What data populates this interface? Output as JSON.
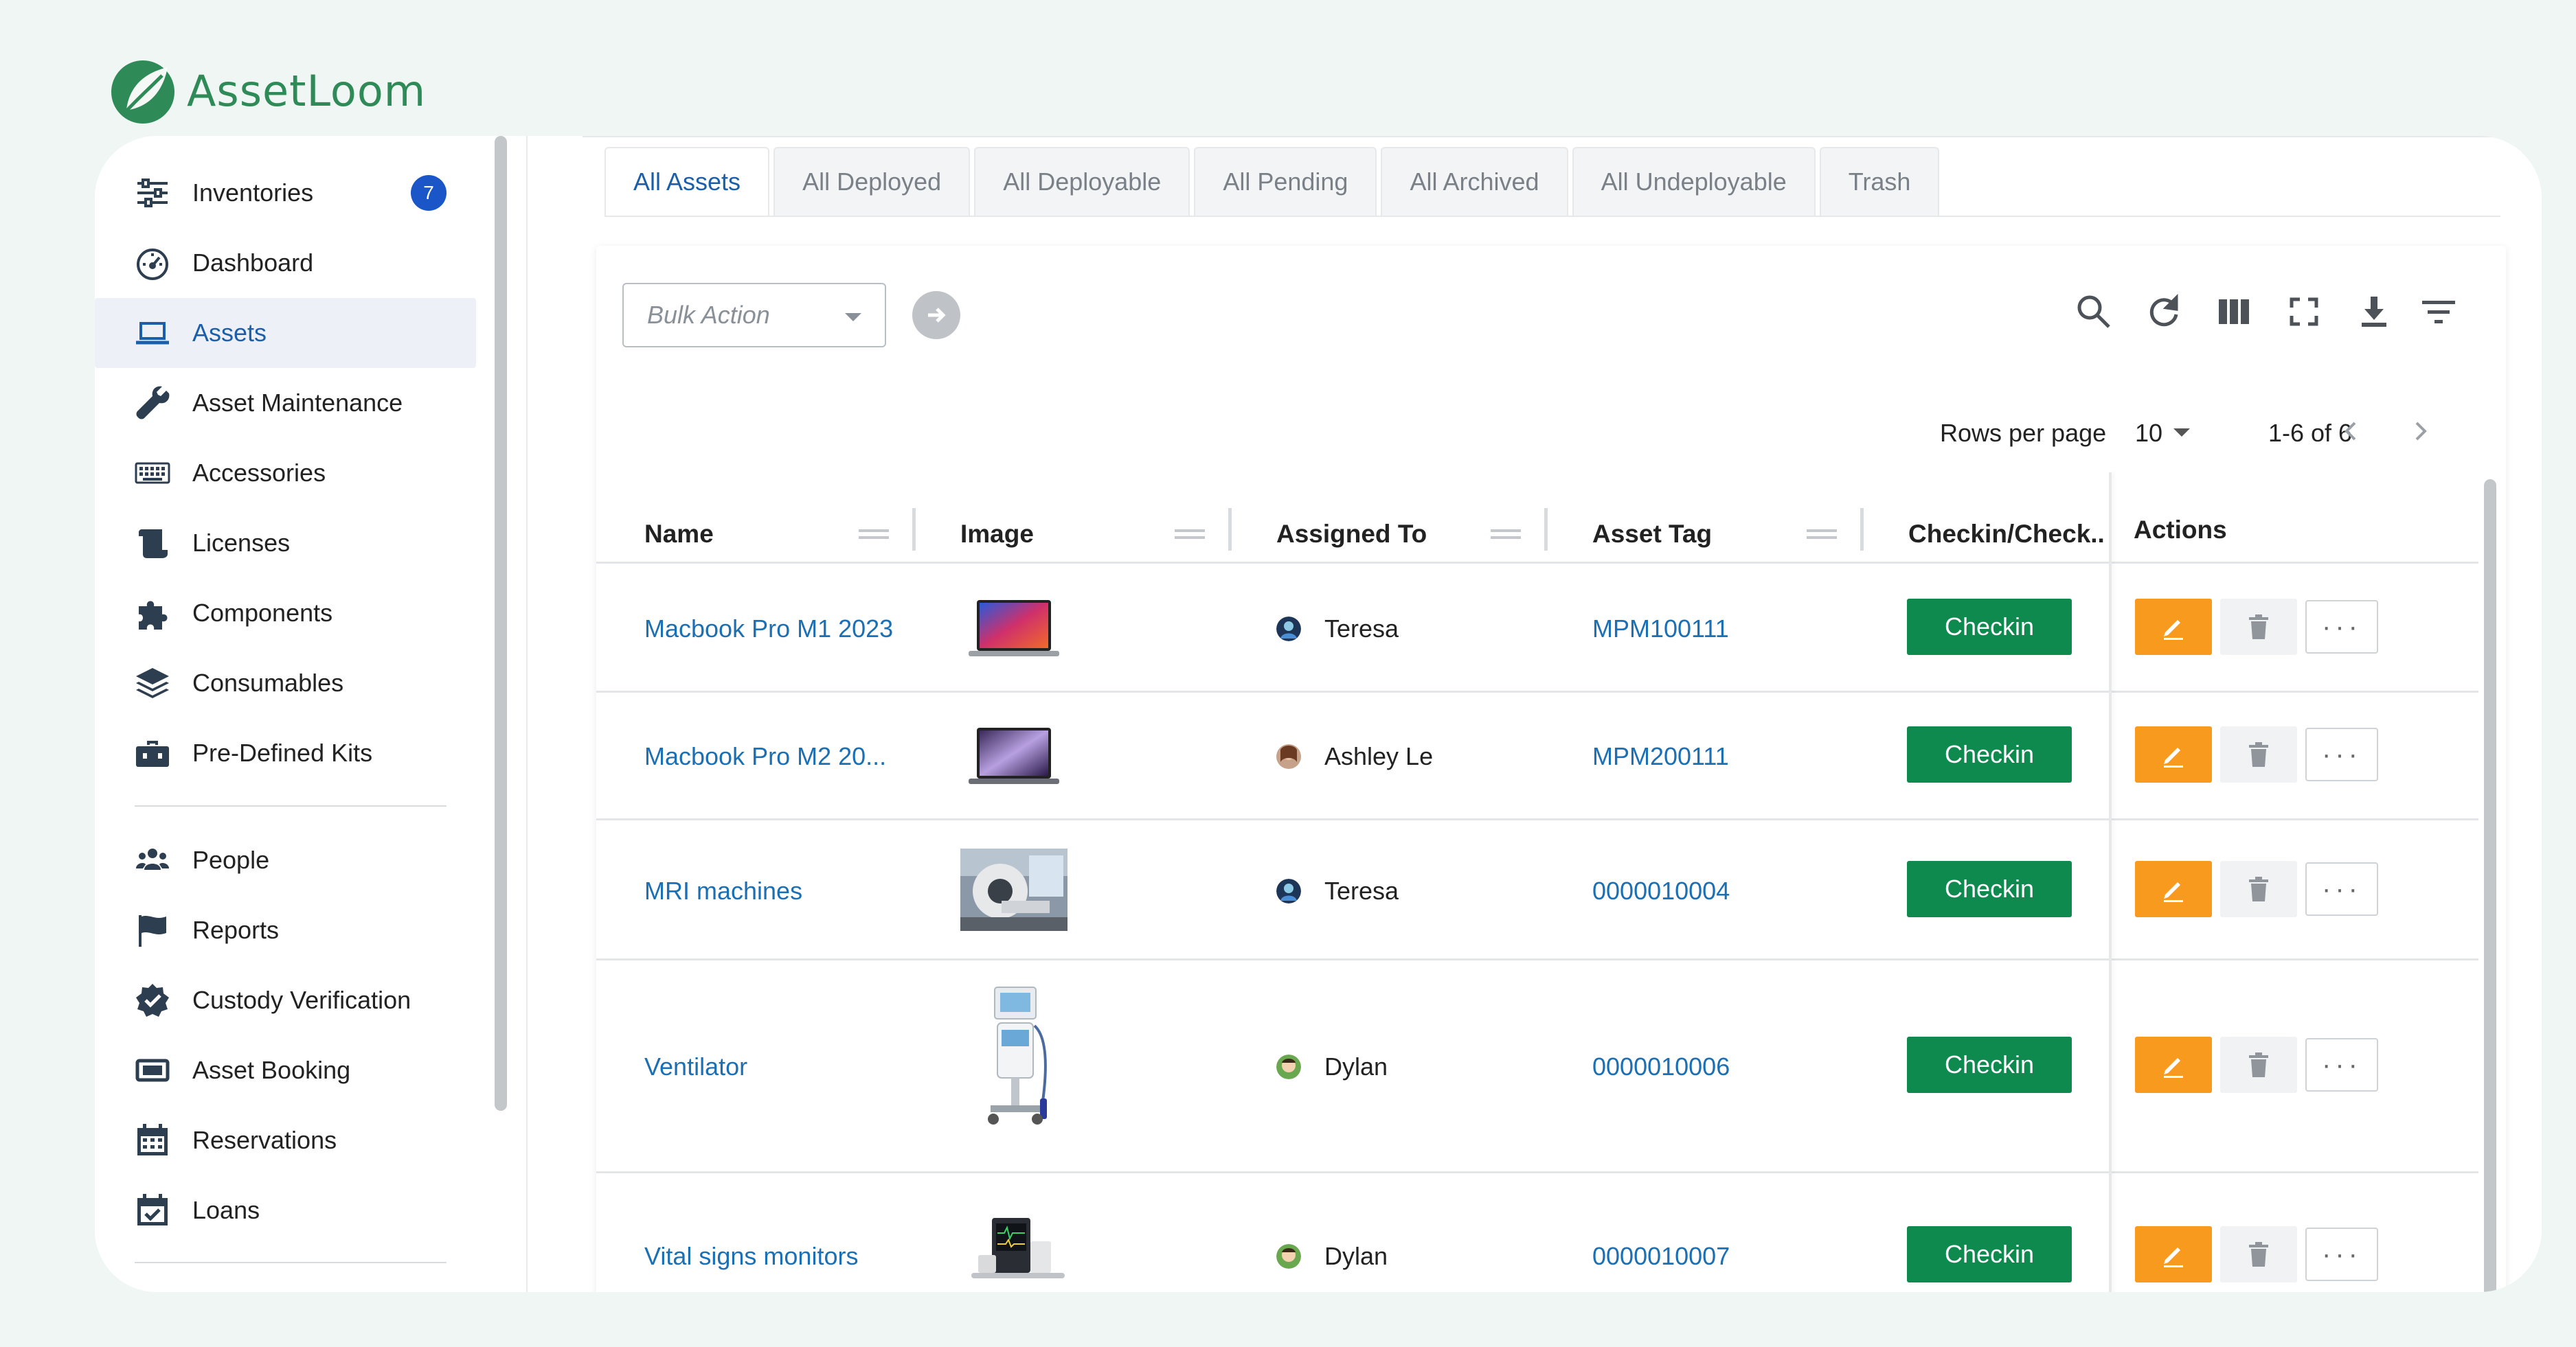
{
  "brand": {
    "name": "AssetLoom",
    "accent": "#2e8b58"
  },
  "sidebar": {
    "items": [
      {
        "label": "Inventories",
        "icon": "sliders-icon",
        "badge": "7"
      },
      {
        "label": "Dashboard",
        "icon": "gauge-icon"
      },
      {
        "label": "Assets",
        "icon": "laptop-icon",
        "active": true
      },
      {
        "label": "Asset Maintenance",
        "icon": "wrench-icon"
      },
      {
        "label": "Accessories",
        "icon": "keyboard-icon"
      },
      {
        "label": "Licenses",
        "icon": "scroll-icon"
      },
      {
        "label": "Components",
        "icon": "puzzle-icon"
      },
      {
        "label": "Consumables",
        "icon": "layers-icon"
      },
      {
        "label": "Pre-Defined Kits",
        "icon": "toolbox-icon"
      },
      {
        "label": "People",
        "icon": "users-icon"
      },
      {
        "label": "Reports",
        "icon": "flag-icon"
      },
      {
        "label": "Custody Verification",
        "icon": "badge-check-icon"
      },
      {
        "label": "Asset Booking",
        "icon": "ticket-icon"
      },
      {
        "label": "Reservations",
        "icon": "calendar-grid-icon"
      },
      {
        "label": "Loans",
        "icon": "calendar-check-icon"
      }
    ]
  },
  "tabs": [
    {
      "label": "All Assets",
      "active": true
    },
    {
      "label": "All Deployed"
    },
    {
      "label": "All Deployable"
    },
    {
      "label": "All Pending"
    },
    {
      "label": "All Archived"
    },
    {
      "label": "All Undeployable"
    },
    {
      "label": "Trash"
    }
  ],
  "toolbar": {
    "bulk_placeholder": "Bulk Action",
    "icons": [
      "search-icon",
      "refresh-icon",
      "columns-icon",
      "fullscreen-icon",
      "download-icon",
      "filter-icon"
    ]
  },
  "pagination": {
    "rows_label": "Rows per page",
    "rows_value": "10",
    "range": "1-6 of 6"
  },
  "table": {
    "columns": [
      "Name",
      "Image",
      "Assigned To",
      "Asset Tag",
      "Checkin/Check..",
      "Actions"
    ],
    "rows": [
      {
        "name": "Macbook Pro M1 2023",
        "assigned": "Teresa",
        "tag": "MPM100111",
        "action": "Checkin",
        "image": "macbook-m1",
        "avatar": "teresa"
      },
      {
        "name": "Macbook Pro M2 20...",
        "assigned": "Ashley Le",
        "tag": "MPM200111",
        "action": "Checkin",
        "image": "macbook-m2",
        "avatar": "ashley"
      },
      {
        "name": "MRI machines",
        "assigned": "Teresa",
        "tag": "0000010004",
        "action": "Checkin",
        "image": "mri",
        "avatar": "teresa"
      },
      {
        "name": "Ventilator",
        "assigned": "Dylan",
        "tag": "0000010006",
        "action": "Checkin",
        "image": "ventilator",
        "avatar": "dylan"
      },
      {
        "name": "Vital signs monitors",
        "assigned": "Dylan",
        "tag": "0000010007",
        "action": "Checkin",
        "image": "monitor",
        "avatar": "dylan"
      }
    ]
  },
  "colors": {
    "link": "#1b6fb4",
    "checkin": "#0e8a4e",
    "edit": "#f79a1d",
    "badge": "#1a56c7"
  }
}
